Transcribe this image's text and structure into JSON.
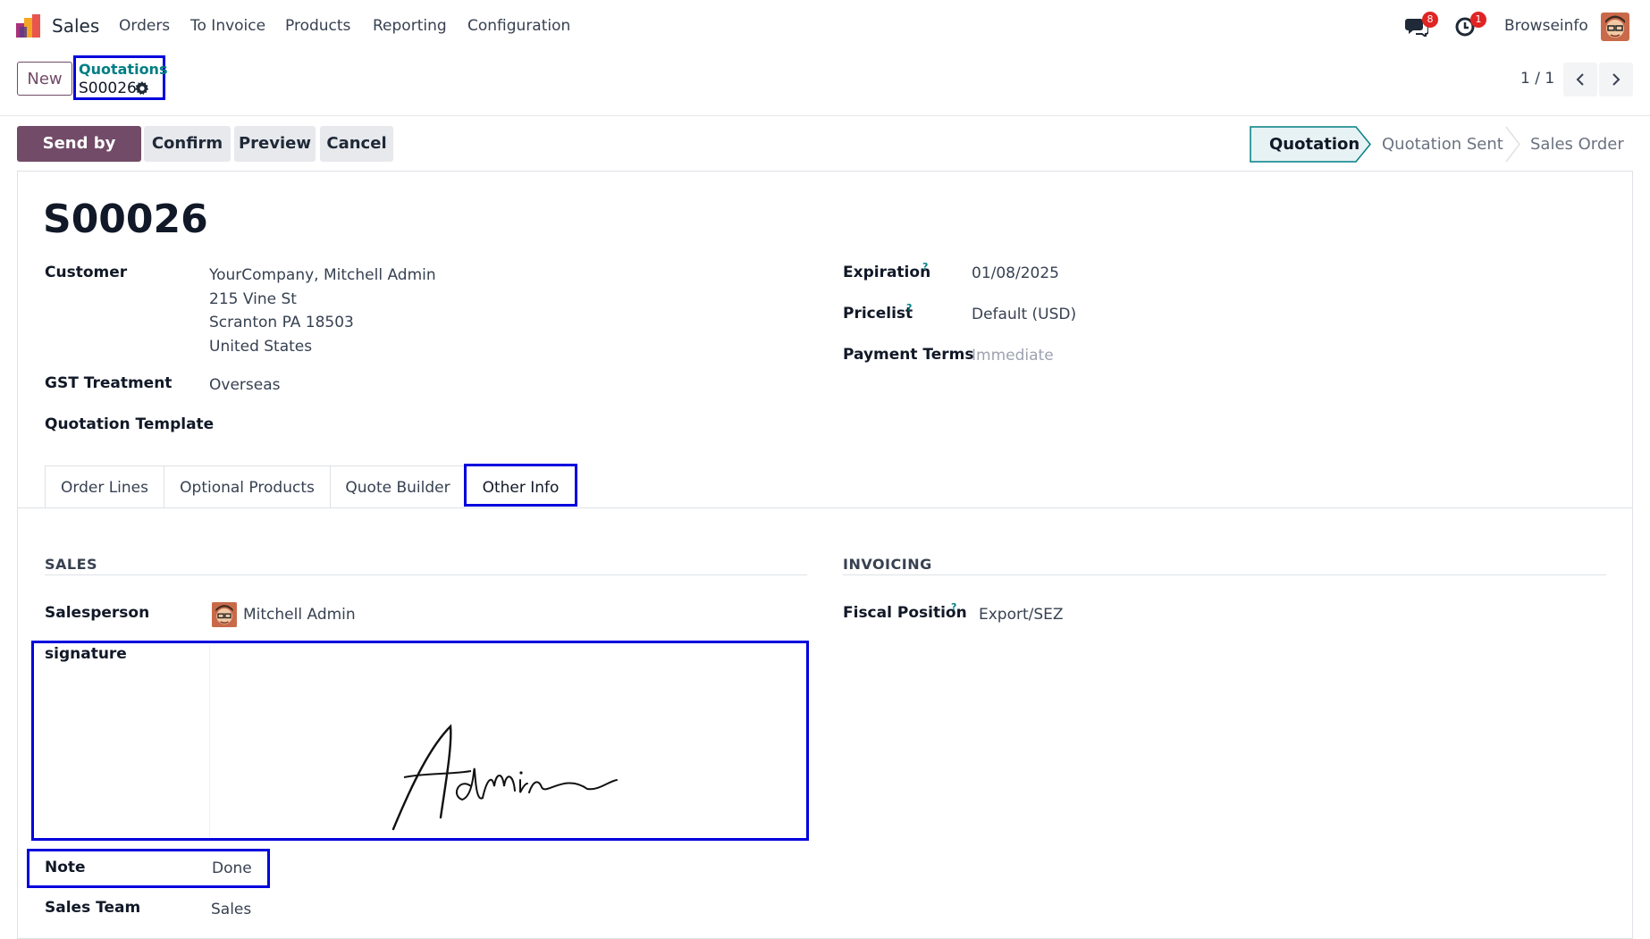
{
  "navbar": {
    "app_name": "Sales",
    "menu": [
      "Orders",
      "To Invoice",
      "Products",
      "Reporting",
      "Configuration"
    ],
    "messages_count": "8",
    "activities_count": "1",
    "company": "Browseinfo"
  },
  "control_panel": {
    "new_label": "New",
    "breadcrumb_parent": "Quotations",
    "breadcrumb_current": "S00026",
    "pager": "1 / 1"
  },
  "actions": {
    "send_email": "Send by Email",
    "confirm": "Confirm",
    "preview": "Preview",
    "cancel": "Cancel"
  },
  "statusbar": {
    "stages": [
      "Quotation",
      "Quotation Sent",
      "Sales Order"
    ],
    "active": "Quotation"
  },
  "record": {
    "name": "S00026",
    "customer_label": "Customer",
    "customer_lines": [
      "YourCompany, Mitchell Admin",
      "215 Vine St",
      "Scranton PA 18503",
      "United States"
    ],
    "gst_label": "GST Treatment",
    "gst_value": "Overseas",
    "template_label": "Quotation Template",
    "expiration_label": "Expiration",
    "expiration_value": "01/08/2025",
    "pricelist_label": "Pricelist",
    "pricelist_value": "Default (USD)",
    "payment_terms_label": "Payment Terms",
    "payment_terms_value": "Immediate",
    "help_mark": "?"
  },
  "tabs": [
    "Order Lines",
    "Optional Products",
    "Quote Builder",
    "Other Info"
  ],
  "active_tab": "Other Info",
  "other_info": {
    "sales_title": "SALES",
    "invoicing_title": "INVOICING",
    "salesperson_label": "Salesperson",
    "salesperson_value": "Mitchell Admin",
    "signature_label": "signature",
    "signature_text": "Admin",
    "note_label": "Note",
    "note_value": "Done",
    "sales_team_label": "Sales Team",
    "sales_team_value": "Sales",
    "fiscal_position_label": "Fiscal Position",
    "fiscal_position_value": "Export/SEZ"
  },
  "colors": {
    "primary": "#714B67",
    "link": "#017e84",
    "highlight": "#0000dd",
    "badge": "#e02424"
  },
  "icons": [
    "sales-app-icon",
    "chat-icon",
    "clock-icon",
    "gear-icon",
    "chevron-left-icon",
    "chevron-right-icon"
  ]
}
